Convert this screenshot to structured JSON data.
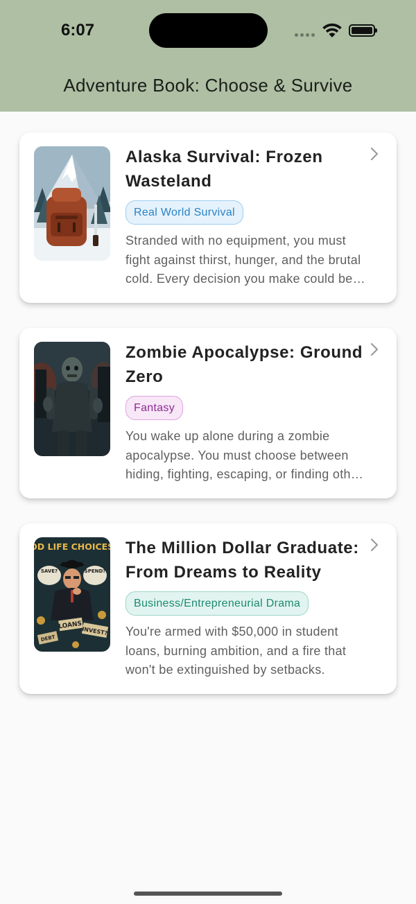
{
  "status_bar": {
    "time": "6:07"
  },
  "app": {
    "title": "Adventure Book: Choose & Survive"
  },
  "books": [
    {
      "title": "Alaska Survival: Frozen Wasteland",
      "genre": "Real World Survival",
      "description": "Stranded with no equipment, you must fight against thirst, hunger, and the brutal cold. Every decision you make could be your last.",
      "cover_icon": "backpack-mountain-cover"
    },
    {
      "title": "Zombie Apocalypse: Ground Zero",
      "genre": "Fantasy",
      "description": "You wake up alone during a zombie apocalypse. You must choose between hiding, fighting, escaping, or finding other survivors.",
      "cover_icon": "zombie-cover"
    },
    {
      "title": "The Million Dollar Graduate: From Dreams to Reality",
      "genre": "Business/Entrepreneurial Drama",
      "description": "You're armed with $50,000 in student loans, burning ambition, and a fire that won't be extinguished by setbacks.",
      "cover_icon": "graduate-choices-cover",
      "cover_text": {
        "headline": "GOOD LIFE CHOICES...?",
        "bubble_left": "SAVE?",
        "bubble_right": "SPEND?",
        "sign_loans": "LOANS",
        "sign_invest": "INVEST?",
        "sign_debt": "DEBT"
      }
    }
  ],
  "colors": {
    "header_bg": "#aebfa4",
    "page_bg": "#fafafa",
    "tag_blue": "#2b83c4",
    "tag_purple": "#8e2a93",
    "tag_teal": "#1c8a71"
  }
}
